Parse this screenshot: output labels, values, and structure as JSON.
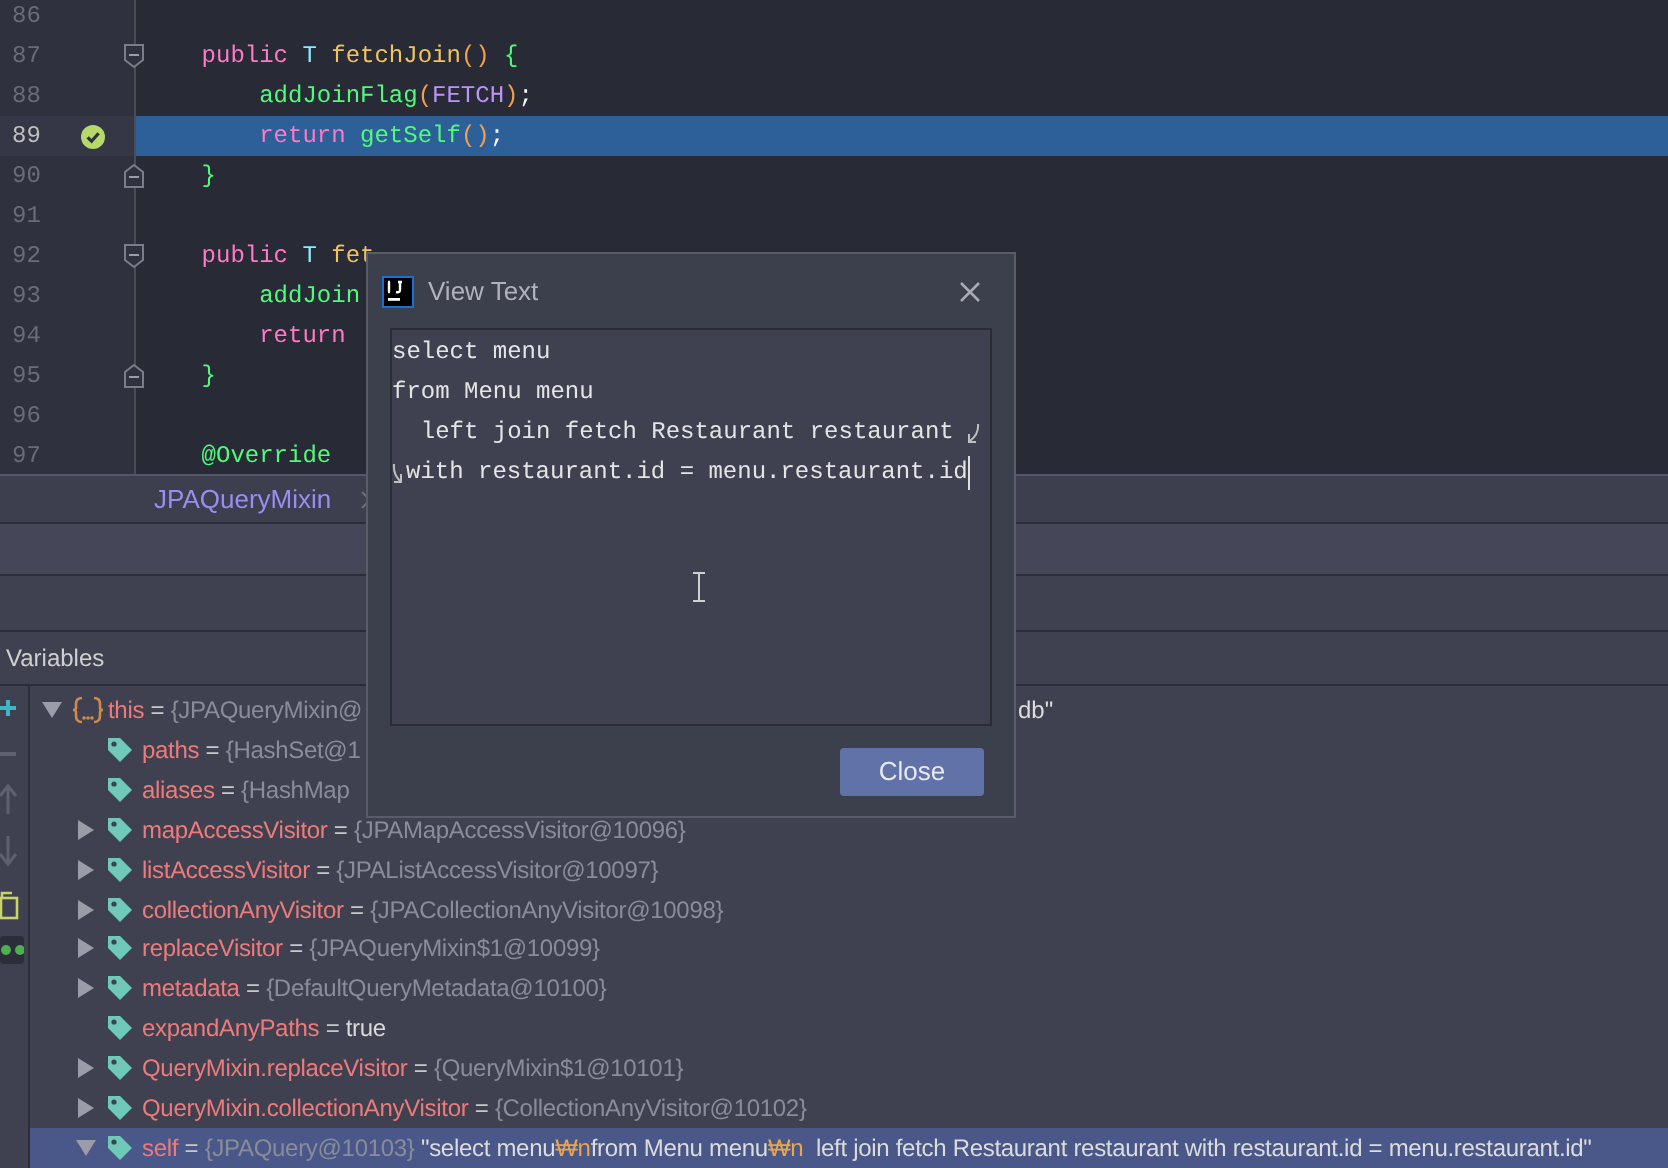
{
  "editor": {
    "lines": [
      {
        "number": "86",
        "current": false,
        "breakpoint": false,
        "fold_open": false,
        "fold_close": false
      },
      {
        "number": "87",
        "current": false,
        "breakpoint": false,
        "fold_open": true,
        "fold_close": false,
        "tokens": [
          {
            "text": "    public",
            "kind": "keyword"
          },
          {
            "text": " T",
            "kind": "type"
          },
          {
            "text": " fetchJoin",
            "kind": "decl"
          },
          {
            "text": "()",
            "kind": "paren"
          },
          {
            "text": " {",
            "kind": "brace"
          }
        ]
      },
      {
        "number": "88",
        "current": false,
        "breakpoint": false,
        "fold_open": false,
        "fold_close": false,
        "tokens": [
          {
            "text": "        addJoinFlag",
            "kind": "call"
          },
          {
            "text": "(",
            "kind": "paren"
          },
          {
            "text": "FETCH",
            "kind": "constant"
          },
          {
            "text": ")",
            "kind": "paren"
          },
          {
            "text": ";",
            "kind": "plain"
          }
        ]
      },
      {
        "number": "89",
        "current": true,
        "breakpoint": true,
        "fold_open": false,
        "fold_close": false,
        "tokens": [
          {
            "text": "        return",
            "kind": "keyword"
          },
          {
            "text": " getSelf",
            "kind": "call"
          },
          {
            "text": "()",
            "kind": "paren"
          },
          {
            "text": ";",
            "kind": "plain"
          }
        ]
      },
      {
        "number": "90",
        "current": false,
        "breakpoint": false,
        "fold_open": false,
        "fold_close": true,
        "tokens": [
          {
            "text": "    }",
            "kind": "brace"
          }
        ]
      },
      {
        "number": "91",
        "current": false,
        "breakpoint": false,
        "fold_open": false,
        "fold_close": false
      },
      {
        "number": "92",
        "current": false,
        "breakpoint": false,
        "fold_open": true,
        "fold_close": false,
        "tokens": [
          {
            "text": "    public",
            "kind": "keyword"
          },
          {
            "text": " T",
            "kind": "type"
          },
          {
            "text": " fet",
            "kind": "decl"
          }
        ]
      },
      {
        "number": "93",
        "current": false,
        "breakpoint": false,
        "fold_open": false,
        "fold_close": false,
        "tokens": [
          {
            "text": "        addJoin",
            "kind": "call"
          }
        ]
      },
      {
        "number": "94",
        "current": false,
        "breakpoint": false,
        "fold_open": false,
        "fold_close": false,
        "tokens": [
          {
            "text": "        return",
            "kind": "keyword"
          }
        ]
      },
      {
        "number": "95",
        "current": false,
        "breakpoint": false,
        "fold_open": false,
        "fold_close": true,
        "tokens": [
          {
            "text": "    }",
            "kind": "brace"
          }
        ]
      },
      {
        "number": "96",
        "current": false,
        "breakpoint": false,
        "fold_open": false,
        "fold_close": false
      },
      {
        "number": "97",
        "current": false,
        "breakpoint": false,
        "fold_open": false,
        "fold_close": false,
        "tokens": [
          {
            "text": "    @Override",
            "kind": "annotation"
          }
        ]
      }
    ]
  },
  "breadcrumb": {
    "items": [
      "JPAQueryMixin"
    ]
  },
  "variables": {
    "title": "Variables",
    "rows": [
      {
        "name": "this",
        "kind": "object",
        "operator": "=",
        "expandable": true,
        "expanded": true,
        "selected": false,
        "value": [
          {
            "text": "{JPAQueryMixin@",
            "kind": "ref"
          }
        ],
        "value_tail": "db\"",
        "children": [
          {
            "name": "paths",
            "kind": "field",
            "operator": "=",
            "expandable": false,
            "expanded": false,
            "selected": false,
            "value": [
              {
                "text": "{HashSet@1",
                "kind": "ref"
              }
            ]
          },
          {
            "name": "aliases",
            "kind": "field",
            "operator": "=",
            "expandable": false,
            "expanded": false,
            "selected": false,
            "value": [
              {
                "text": "{HashMap",
                "kind": "ref"
              }
            ]
          },
          {
            "name": "mapAccessVisitor",
            "kind": "field",
            "operator": "=",
            "expandable": true,
            "expanded": false,
            "selected": false,
            "value": [
              {
                "text": "{JPAMapAccessVisitor@10096}",
                "kind": "ref"
              }
            ]
          },
          {
            "name": "listAccessVisitor",
            "kind": "field",
            "operator": "=",
            "expandable": true,
            "expanded": false,
            "selected": false,
            "value": [
              {
                "text": "{JPAListAccessVisitor@10097}",
                "kind": "ref"
              }
            ]
          },
          {
            "name": "collectionAnyVisitor",
            "kind": "field",
            "operator": "=",
            "expandable": true,
            "expanded": false,
            "selected": false,
            "value": [
              {
                "text": "{JPACollectionAnyVisitor@10098}",
                "kind": "ref"
              }
            ]
          },
          {
            "name": "replaceVisitor",
            "kind": "field",
            "operator": "=",
            "expandable": true,
            "expanded": false,
            "selected": false,
            "value": [
              {
                "text": "{JPAQueryMixin$1@10099}",
                "kind": "ref"
              }
            ]
          },
          {
            "name": "metadata",
            "kind": "field",
            "operator": "=",
            "expandable": true,
            "expanded": false,
            "selected": false,
            "value": [
              {
                "text": "{DefaultQueryMetadata@10100}",
                "kind": "ref"
              }
            ]
          },
          {
            "name": "expandAnyPaths",
            "kind": "field",
            "operator": "=",
            "expandable": false,
            "expanded": false,
            "selected": false,
            "value": [
              {
                "text": "true",
                "kind": "literal"
              }
            ]
          },
          {
            "name": "QueryMixin.replaceVisitor",
            "kind": "field",
            "operator": "=",
            "expandable": true,
            "expanded": false,
            "selected": false,
            "value": [
              {
                "text": "{QueryMixin$1@10101}",
                "kind": "ref"
              }
            ]
          },
          {
            "name": "QueryMixin.collectionAnyVisitor",
            "kind": "field",
            "operator": "=",
            "expandable": true,
            "expanded": false,
            "selected": false,
            "value": [
              {
                "text": "{CollectionAnyVisitor@10102}",
                "kind": "ref"
              }
            ]
          },
          {
            "name": "self",
            "kind": "field",
            "operator": "=",
            "expandable": true,
            "expanded": true,
            "selected": true,
            "value": [
              {
                "text": "{JPAQuery@10103}",
                "kind": "ref"
              },
              {
                "text": " \"select menu",
                "kind": "string"
              },
              {
                "text": "₩n",
                "kind": "escape"
              },
              {
                "text": "from Menu menu",
                "kind": "string"
              },
              {
                "text": "₩n",
                "kind": "escape"
              },
              {
                "text": "  left join fetch Restaurant restaurant with restaurant.id = menu.restaurant.id\"",
                "kind": "string"
              }
            ]
          }
        ]
      }
    ]
  },
  "dialog": {
    "title": "View Text",
    "text_lines": [
      {
        "text": "select menu",
        "soft_wrap": false
      },
      {
        "text": "from Menu menu",
        "soft_wrap": false
      },
      {
        "text": "  left join fetch Restaurant restaurant",
        "soft_wrap": true
      },
      {
        "text": "with restaurant.id = menu.restaurant.id",
        "soft_wrap": false
      }
    ],
    "caret_at_end": true,
    "button": "Close"
  }
}
